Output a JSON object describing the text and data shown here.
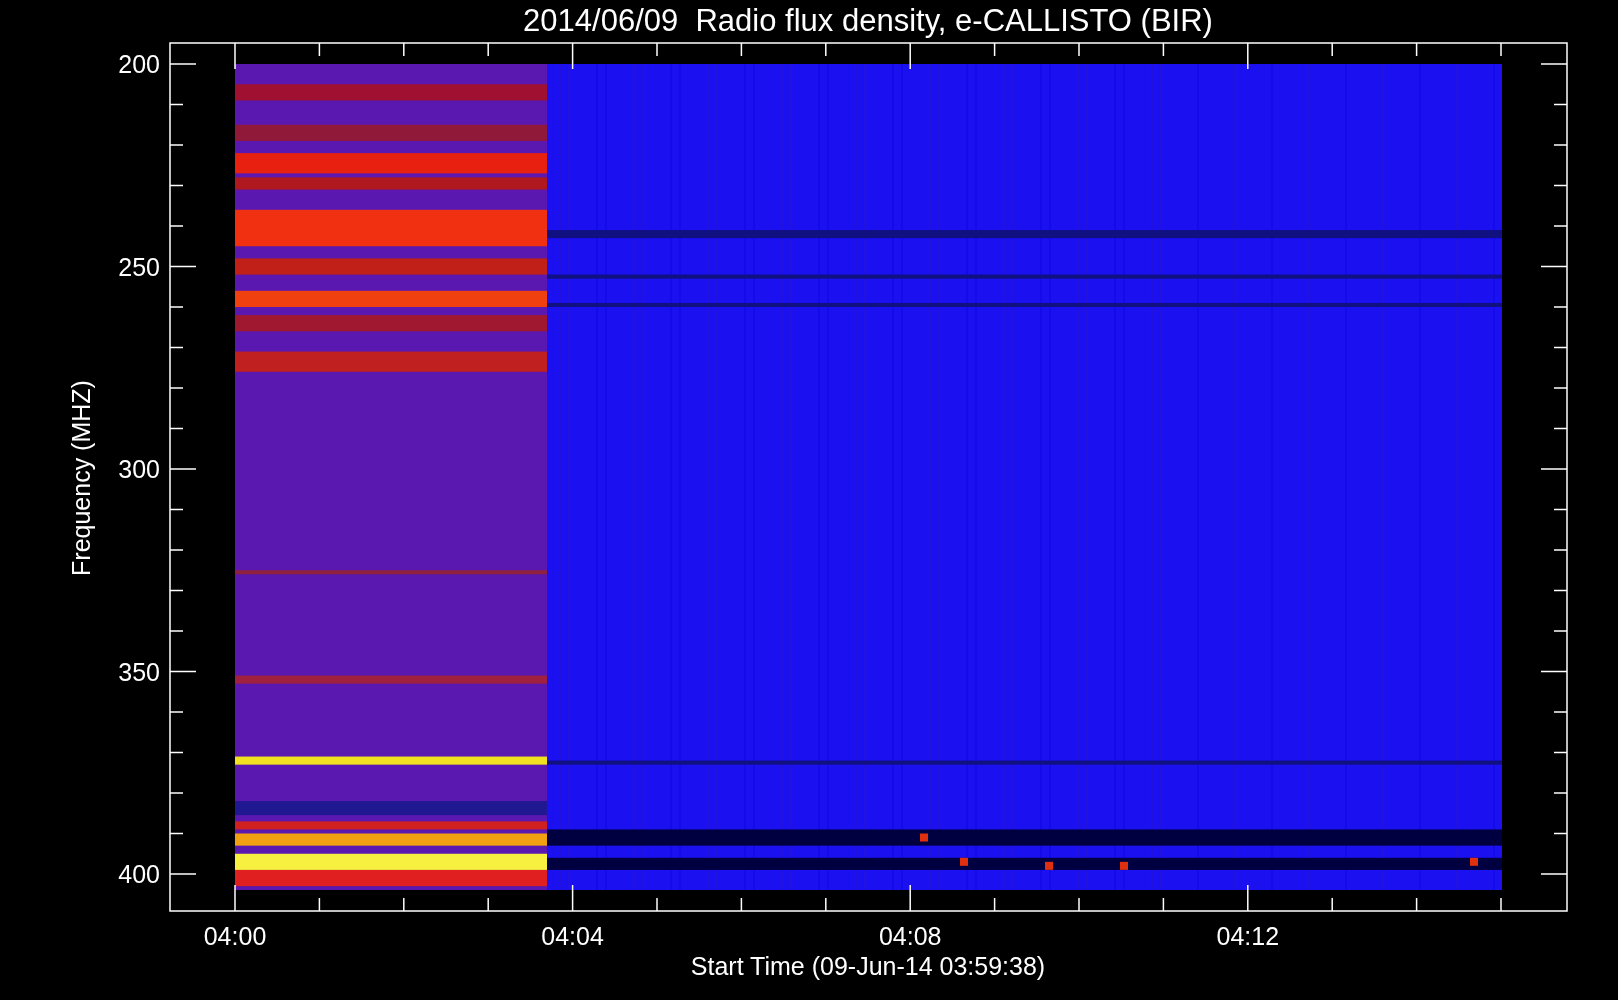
{
  "plot": {
    "title": "2014/06/09  Radio flux density, e-CALLISTO (BIR)",
    "ylabel": "Frequency (MHZ)",
    "xlabel": "Start Time (09-Jun-14 03:59:38)",
    "yticks": [
      "200",
      "250",
      "300",
      "350",
      "400"
    ],
    "xticks": [
      "04:00",
      "04:04",
      "04:08",
      "04:12"
    ]
  }
}
